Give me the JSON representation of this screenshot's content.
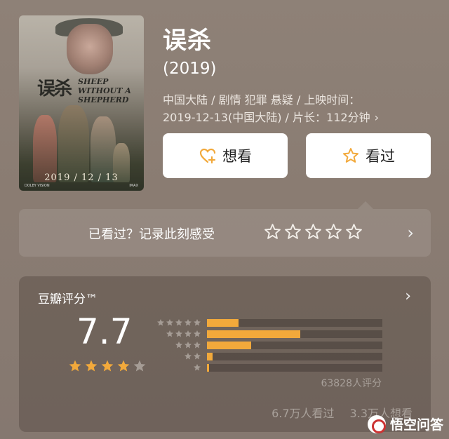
{
  "movie": {
    "title": "误杀",
    "year": "(2019)",
    "meta_line1": "中国大陆 / 剧情 犯罪 悬疑 / 上映时间：",
    "meta_line2": "2019-12-13(中国大陆) / 片长：112分钟",
    "meta_chevron": "chevron-right-icon"
  },
  "poster": {
    "title_cn": "误杀",
    "title_en": "SHEEP WITHOUT A SHEPHERD",
    "date": "2019 / 12 / 13",
    "logo_left": "DOLBY VISION",
    "logo_right": "IMAX"
  },
  "actions": {
    "want_label": "想看",
    "want_icon": "heart-plus-icon",
    "seen_label": "看过",
    "seen_icon": "star-outline-icon",
    "icon_color": "#f2a93b"
  },
  "rate_prompt": {
    "label": "已看过？记录此刻感受",
    "stars": 5,
    "chevron": "chevron-right-icon"
  },
  "rating": {
    "title": "豆瓣评分™",
    "score": "7.7",
    "stars_filled": 4,
    "stars_total": 5,
    "distribution": [
      {
        "stars": 5,
        "fraction": 0.18
      },
      {
        "stars": 4,
        "fraction": 0.53
      },
      {
        "stars": 3,
        "fraction": 0.25
      },
      {
        "stars": 2,
        "fraction": 0.03
      },
      {
        "stars": 1,
        "fraction": 0.01
      }
    ],
    "count": "63828人评分",
    "seen": "6.7万人看过",
    "want": "3.3万人想看",
    "fill_color": "#f2a93b"
  },
  "watermark": {
    "text": "悟空问答"
  }
}
